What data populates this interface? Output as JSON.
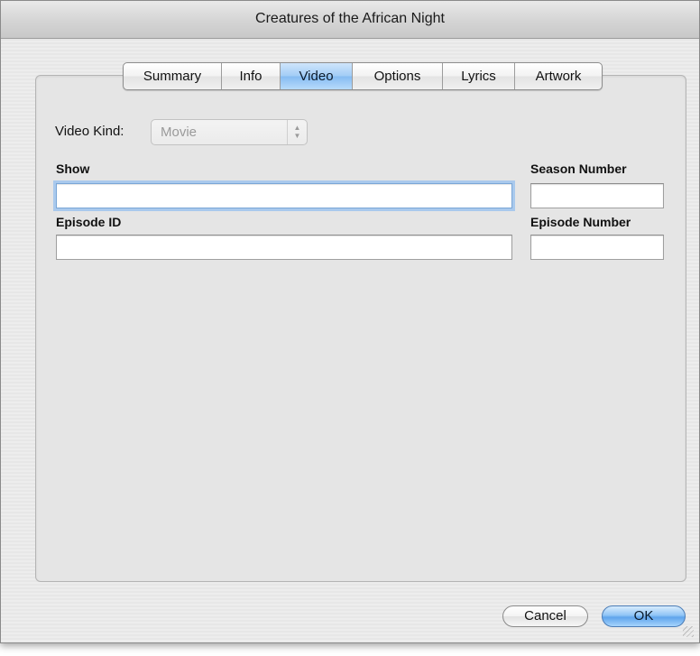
{
  "window": {
    "title": "Creatures of the African Night"
  },
  "tabs": [
    {
      "label": "Summary",
      "active": false
    },
    {
      "label": "Info",
      "active": false
    },
    {
      "label": "Video",
      "active": true
    },
    {
      "label": "Options",
      "active": false
    },
    {
      "label": "Lyrics",
      "active": false
    },
    {
      "label": "Artwork",
      "active": false
    }
  ],
  "video": {
    "kind_label": "Video Kind:",
    "kind_value": "Movie",
    "show_label": "Show",
    "show_value": "",
    "season_number_label": "Season Number",
    "season_number_value": "",
    "episode_id_label": "Episode ID",
    "episode_id_value": "",
    "episode_number_label": "Episode Number",
    "episode_number_value": ""
  },
  "buttons": {
    "cancel": "Cancel",
    "ok": "OK"
  },
  "colors": {
    "accent_tab": "#a3cdf6",
    "default_button": "#5fa4ec"
  },
  "icons": {
    "popup_arrows": "up-down-arrows-icon",
    "resize_grip": "resize-grip-icon"
  }
}
